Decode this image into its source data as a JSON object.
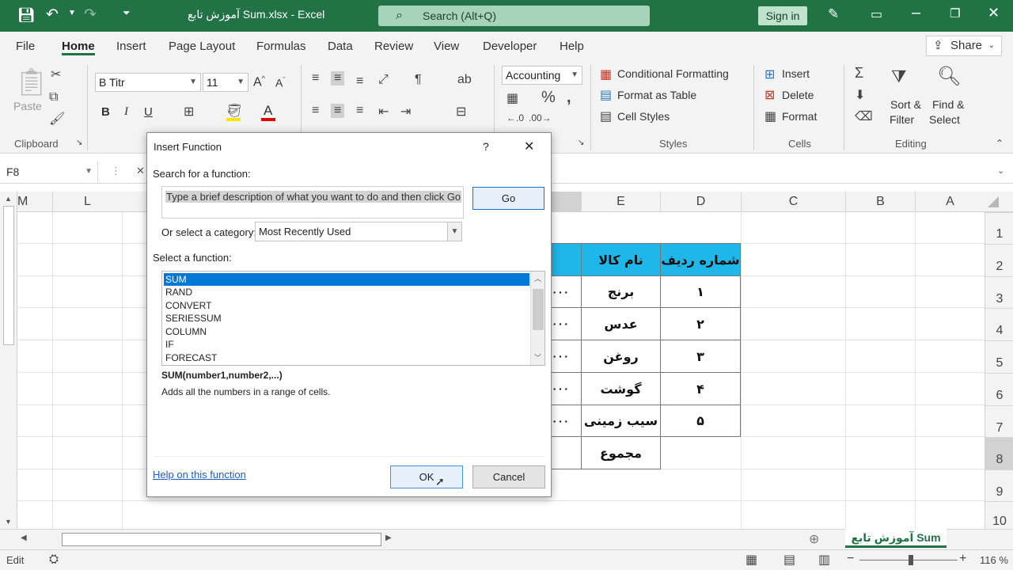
{
  "titlebar": {
    "filename": "آموزش تابع Sum.xlsx",
    "app": "Excel",
    "search_placeholder": "Search (Alt+Q)",
    "signin": "Sign in"
  },
  "ribbon_tabs": [
    "File",
    "Home",
    "Insert",
    "Page Layout",
    "Formulas",
    "Data",
    "Review",
    "View",
    "Developer",
    "Help"
  ],
  "share": "Share",
  "ribbon": {
    "font_name": "B Titr",
    "font_size": "11",
    "number_format": "Accounting",
    "groups": {
      "clipboard": "Clipboard",
      "styles": "Styles",
      "cells": "Cells",
      "editing": "Editing"
    },
    "paste": "Paste",
    "conditional_formatting": "Conditional Formatting",
    "format_as_table": "Format as Table",
    "cell_styles": "Cell Styles",
    "insert": "Insert",
    "delete": "Delete",
    "format": "Format",
    "sort_filter_1": "Sort &",
    "sort_filter_2": "Filter",
    "find_select_1": "Find &",
    "find_select_2": "Select"
  },
  "namebox": "F8",
  "columns": [
    "M",
    "L",
    "E",
    "D",
    "C",
    "B",
    "A"
  ],
  "rows": [
    "1",
    "2",
    "3",
    "4",
    "5",
    "6",
    "7",
    "8",
    "9",
    "10"
  ],
  "sheet": {
    "header_d": "شماره ردیف",
    "header_e": "نام کالا",
    "items": [
      {
        "num": "۱",
        "name": "برنج"
      },
      {
        "num": "۲",
        "name": "عدس"
      },
      {
        "num": "۳",
        "name": "روغن"
      },
      {
        "num": "۴",
        "name": "گوشت"
      },
      {
        "num": "۵",
        "name": "سیب زمینی"
      }
    ],
    "total_label": "مجموع",
    "f_partial": [
      "۰۰۰",
      "۰۰۰",
      "۰۰۰",
      "۰۰۰",
      "۰۰۰"
    ]
  },
  "sheet_tab": "آموزش تابع Sum",
  "status": {
    "mode": "Edit",
    "zoom": "116 %"
  },
  "dialog": {
    "title": "Insert Function",
    "help_q": "?",
    "search_label": "Search for a function:",
    "search_text": "Type a brief description of what you want to do and then click Go",
    "go": "Go",
    "category_label": "Or select a category:",
    "category_value": "Most Recently Used",
    "select_label": "Select a function:",
    "functions": [
      "SUM",
      "RAND",
      "CONVERT",
      "SERIESSUM",
      "COLUMN",
      "IF",
      "FORECAST"
    ],
    "signature": "SUM(number1,number2,...)",
    "description": "Adds all the numbers in a range of cells.",
    "help_link": "Help on this function",
    "ok": "OK",
    "cancel": "Cancel"
  },
  "colors": {
    "excel_green": "#217346",
    "selection_blue": "#0078d7",
    "header_cyan": "#1fb6e9"
  }
}
